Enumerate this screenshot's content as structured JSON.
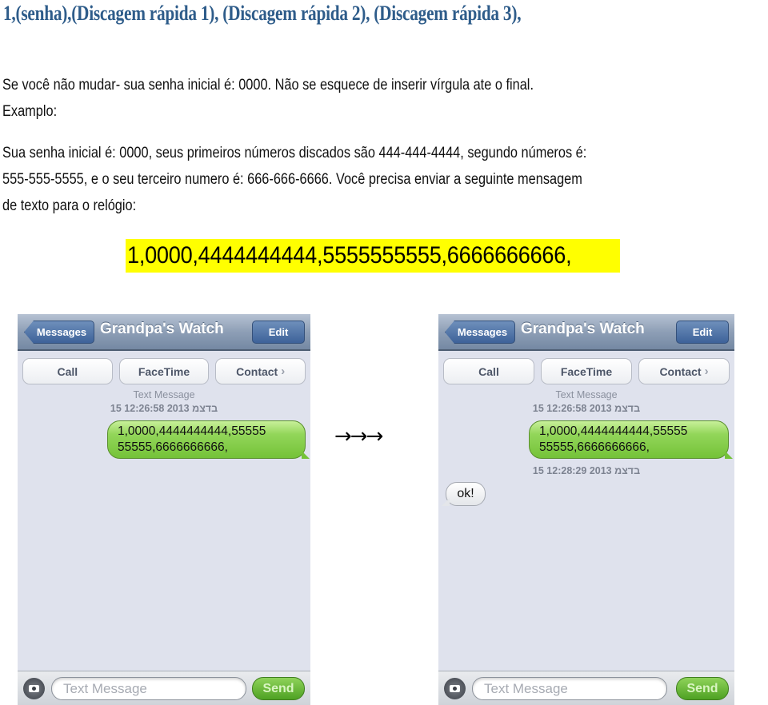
{
  "heading": "1,(senha),(Discagem rápida 1), (Discagem rápida 2), (Discagem rápida 3),",
  "paragraph1": {
    "line1": "Se você não mudar- sua senha inicial é: 0000. Não se esquece de inserir vírgula ate o final.",
    "line2": "Examplo:"
  },
  "paragraph2": {
    "line1": "Sua senha inicial é: 0000, seus primeiros números discados são 444-444-4444, segundo números é:",
    "line2": "555-555-5555, e o seu terceiro numero é: 666-666-6666. Você precisa enviar a seguinte mensagem",
    "line3": "de texto para o relógio:"
  },
  "highlighted_command": "1,0000,4444444444,5555555555,6666666666,",
  "transition_arrows": "→→→",
  "phones": [
    {
      "nav": {
        "back_label": "Messages",
        "title": "Grandpa's Watch",
        "edit_label": "Edit"
      },
      "actions": {
        "call": "Call",
        "facetime": "FaceTime",
        "contact": "Contact",
        "contact_chevron": "›"
      },
      "message_type": "Text Message",
      "sent_timestamp": "15 בדצמ 2013 12:26:58",
      "sent_message": {
        "line1": "1,0000,4444444444,55555",
        "line2": "55555,6666666666,"
      },
      "composer": {
        "placeholder": "Text Message",
        "send_label": "Send",
        "camera_icon": "camera-icon"
      }
    },
    {
      "nav": {
        "back_label": "Messages",
        "title": "Grandpa's Watch",
        "edit_label": "Edit"
      },
      "actions": {
        "call": "Call",
        "facetime": "FaceTime",
        "contact": "Contact",
        "contact_chevron": "›"
      },
      "message_type": "Text Message",
      "sent_timestamp": "15 בדצמ 2013 12:26:58",
      "sent_message": {
        "line1": "1,0000,4444444444,55555",
        "line2": "55555,6666666666,"
      },
      "reply_timestamp": "15 בדצמ 2013 12:28:29",
      "reply_message": "ok!",
      "composer": {
        "placeholder": "Text Message",
        "send_label": "Send",
        "camera_icon": "camera-icon"
      }
    }
  ],
  "colors": {
    "heading": "#2e5c8a",
    "highlight": "#ffff00",
    "sent_bubble": "#74c238",
    "nav_button": "#3d6299",
    "chat_background": "#dfe2ed"
  }
}
